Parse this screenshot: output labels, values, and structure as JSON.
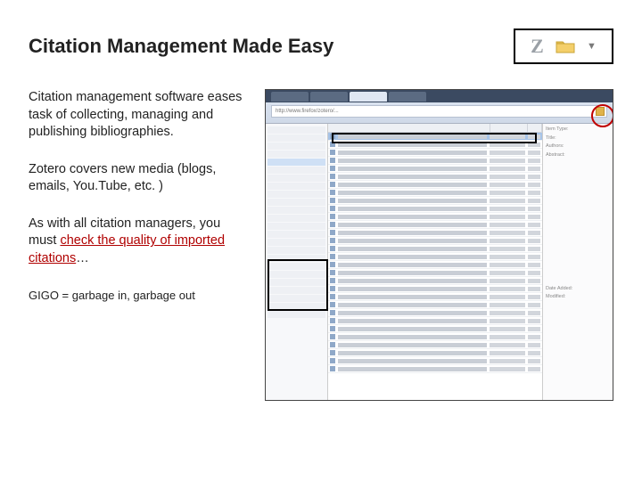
{
  "title": "Citation Management Made Easy",
  "toolbar": {
    "letter": "Z"
  },
  "para1": "Citation management software eases task of collecting, managing and publishing bibliographies.",
  "para2": "Zotero covers new media (blogs, emails, You.Tube, etc. )",
  "para3_a": "As with all citation managers, you must ",
  "para3_u": "check the quality of imported citations",
  "para3_b": "…",
  "gigo": "GIGO = garbage in, garbage out",
  "screenshot": {
    "address": "http://www.firefox/zotero/...",
    "right_panel": {
      "item_type": "Item Type:",
      "title_lbl": "Title:",
      "authors": "Authors:",
      "abstract": "Abstract:",
      "date_added": "Date Added:",
      "modified": "Modified:"
    }
  }
}
